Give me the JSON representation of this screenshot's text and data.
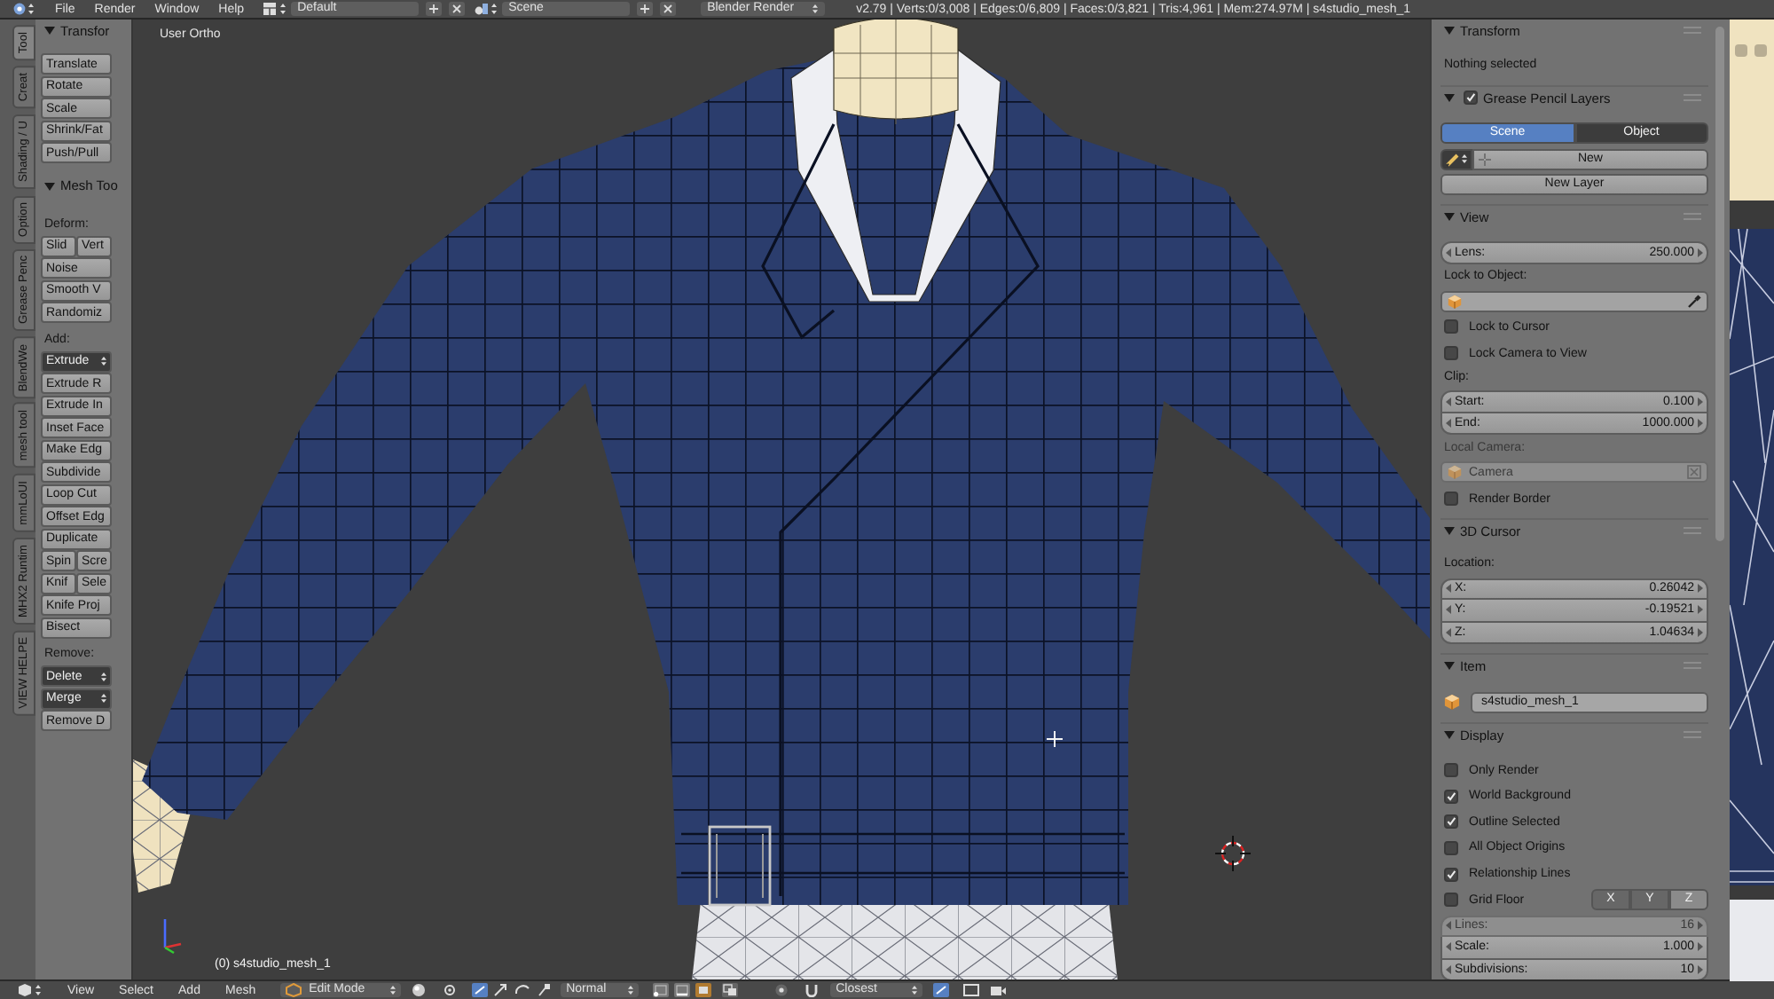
{
  "top_bar": {
    "menus": [
      "File",
      "Render",
      "Window",
      "Help"
    ],
    "layout": "Default",
    "scene": "Scene",
    "engine": "Blender Render",
    "stats": "v2.79 | Verts:0/3,008 | Edges:0/6,809 | Faces:0/3,821 | Tris:4,961 | Mem:274.97M | s4studio_mesh_1"
  },
  "tool_tabs": [
    {
      "label": "Tool",
      "selected": true
    },
    {
      "label": "Creat",
      "selected": false
    },
    {
      "label": "Shading / U",
      "selected": false
    },
    {
      "label": "Option",
      "selected": false
    },
    {
      "label": "Grease Penc",
      "selected": false
    },
    {
      "label": "BlendWe",
      "selected": false
    },
    {
      "label": "mesh tool",
      "selected": false
    },
    {
      "label": "mmLoUI",
      "selected": false
    },
    {
      "label": "MHX2 Runtim",
      "selected": false
    },
    {
      "label": "VIEW HELPE",
      "selected": false
    }
  ],
  "tool_shelf": {
    "panels": [
      {
        "title": "Transfor",
        "expanded": true,
        "items": [
          {
            "kind": "button",
            "labels": [
              "Translate"
            ]
          },
          {
            "kind": "button",
            "labels": [
              "Rotate"
            ]
          },
          {
            "kind": "button",
            "labels": [
              "Scale"
            ]
          },
          {
            "kind": "button",
            "labels": [
              "Shrink/Fat"
            ]
          },
          {
            "kind": "button",
            "labels": [
              "Push/Pull"
            ]
          }
        ]
      },
      {
        "title": "Mesh Too",
        "expanded": true,
        "items": [
          {
            "kind": "label",
            "text": "Deform:"
          },
          {
            "kind": "button",
            "labels": [
              "Slid",
              "Vert"
            ]
          },
          {
            "kind": "button",
            "labels": [
              "Noise"
            ]
          },
          {
            "kind": "button",
            "labels": [
              "Smooth V"
            ]
          },
          {
            "kind": "button",
            "labels": [
              "Randomiz"
            ]
          },
          {
            "kind": "label",
            "text": "Add:"
          },
          {
            "kind": "menu",
            "labels": [
              "Extrude"
            ]
          },
          {
            "kind": "button",
            "labels": [
              "Extrude R"
            ]
          },
          {
            "kind": "button",
            "labels": [
              "Extrude In"
            ]
          },
          {
            "kind": "button",
            "labels": [
              "Inset Face"
            ]
          },
          {
            "kind": "button",
            "labels": [
              "Make Edg"
            ]
          },
          {
            "kind": "button",
            "labels": [
              "Subdivide"
            ]
          },
          {
            "kind": "button",
            "labels": [
              "Loop Cut"
            ]
          },
          {
            "kind": "button",
            "labels": [
              "Offset Edg"
            ]
          },
          {
            "kind": "button",
            "labels": [
              "Duplicate"
            ]
          },
          {
            "kind": "button",
            "labels": [
              "Spin",
              "Scre"
            ]
          },
          {
            "kind": "button",
            "labels": [
              "Knif",
              "Sele"
            ]
          },
          {
            "kind": "button",
            "labels": [
              "Knife Proj"
            ]
          },
          {
            "kind": "button",
            "labels": [
              "Bisect"
            ]
          },
          {
            "kind": "label",
            "text": "Remove:"
          },
          {
            "kind": "menu",
            "labels": [
              "Delete"
            ]
          },
          {
            "kind": "menu",
            "labels": [
              "Merge"
            ]
          },
          {
            "kind": "button",
            "labels": [
              "Remove D"
            ]
          }
        ]
      }
    ]
  },
  "viewport": {
    "view_name": "User Ortho",
    "object_label": "(0) s4studio_mesh_1"
  },
  "properties": {
    "panels": [
      {
        "title": "Transform",
        "expanded": true,
        "rows": [
          {
            "kind": "text",
            "text": "Nothing selected"
          }
        ]
      },
      {
        "title": "Grease Pencil Layers",
        "expanded": true,
        "header_checked": true,
        "rows": [
          {
            "kind": "radio",
            "options": [
              {
                "label": "Scene",
                "selected": true
              },
              {
                "label": "Object",
                "selected": false
              }
            ]
          },
          {
            "kind": "new",
            "label": "New"
          },
          {
            "kind": "button",
            "label": "New Layer"
          }
        ]
      },
      {
        "title": "View",
        "expanded": true,
        "rows": [
          {
            "kind": "number",
            "label": "Lens:",
            "value": "250.000",
            "disabled": false
          },
          {
            "kind": "label",
            "text": "Lock to Object:",
            "disabled": false
          },
          {
            "kind": "object_picker",
            "disabled": false
          },
          {
            "kind": "checkbox",
            "label": "Lock to Cursor",
            "checked": false
          },
          {
            "kind": "checkbox",
            "label": "Lock Camera to View",
            "checked": false
          },
          {
            "kind": "label",
            "text": "Clip:",
            "disabled": false
          },
          {
            "kind": "number",
            "label": "Start:",
            "value": "0.100",
            "disabled": false
          },
          {
            "kind": "number",
            "label": "End:",
            "value": "1000.000",
            "disabled": false
          },
          {
            "kind": "label",
            "text": "Local Camera:",
            "disabled": true
          },
          {
            "kind": "object",
            "value": "Camera",
            "disabled": true
          },
          {
            "kind": "checkbox",
            "label": "Render Border",
            "checked": false
          }
        ]
      },
      {
        "title": "3D Cursor",
        "expanded": true,
        "rows": [
          {
            "kind": "label",
            "text": "Location:",
            "disabled": false
          },
          {
            "kind": "number",
            "label": "X:",
            "value": "0.26042",
            "disabled": false
          },
          {
            "kind": "number",
            "label": "Y:",
            "value": "-0.19521",
            "disabled": false
          },
          {
            "kind": "number",
            "label": "Z:",
            "value": "1.04634",
            "disabled": false
          }
        ]
      },
      {
        "title": "Item",
        "expanded": true,
        "rows": [
          {
            "kind": "name",
            "value": "s4studio_mesh_1"
          }
        ]
      },
      {
        "title": "Display",
        "expanded": true,
        "rows": [
          {
            "kind": "checkbox",
            "label": "Only Render",
            "checked": false
          },
          {
            "kind": "checkbox",
            "label": "World Background",
            "checked": true
          },
          {
            "kind": "checkbox",
            "label": "Outline Selected",
            "checked": true
          },
          {
            "kind": "checkbox",
            "label": "All Object Origins",
            "checked": false
          },
          {
            "kind": "checkbox",
            "label": "Relationship Lines",
            "checked": true
          },
          {
            "kind": "checkbox",
            "label": "Grid Floor",
            "checked": false,
            "toggles": [
              {
                "label": "X",
                "on": true
              },
              {
                "label": "Y",
                "on": true
              },
              {
                "label": "Z",
                "on": false
              }
            ]
          },
          {
            "kind": "number",
            "label": "Lines:",
            "value": "16",
            "disabled": true
          },
          {
            "kind": "number",
            "label": "Scale:",
            "value": "1.000",
            "disabled": false
          },
          {
            "kind": "number",
            "label": "Subdivisions:",
            "value": "10",
            "disabled": false
          }
        ]
      }
    ]
  },
  "bottom_bar": {
    "menus": [
      "View",
      "Select",
      "Add",
      "Mesh"
    ],
    "mode": "Edit Mode",
    "orientation": "Normal",
    "snap": "Closest"
  }
}
